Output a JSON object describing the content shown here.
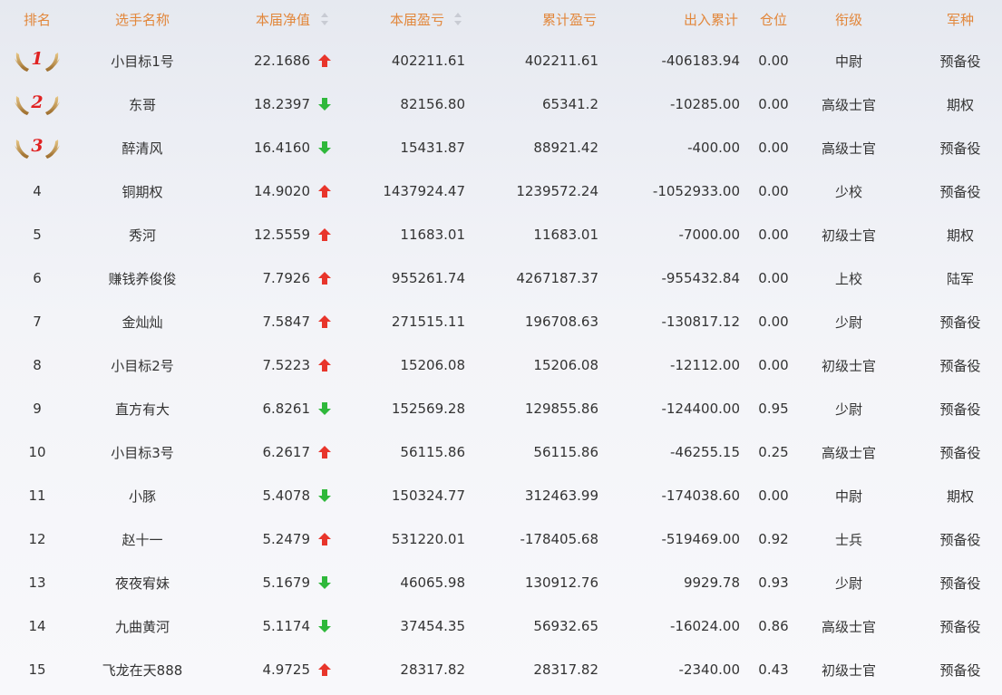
{
  "header": {
    "rank": "排名",
    "name": "选手名称",
    "nav": "本届净值",
    "profit": "本届盈亏",
    "cumulative": "累计盈亏",
    "flow": "出入累计",
    "position": "仓位",
    "military_rank": "衔级",
    "arm": "军种"
  },
  "colors": {
    "header_text": "#e2873b",
    "up_arrow": "#e8352b",
    "down_arrow": "#2fb83b",
    "medal_number": "#e02222"
  },
  "rows": [
    {
      "rank": "1",
      "medal": true,
      "name": "小目标1号",
      "nav": "22.1686",
      "trend": "up",
      "profit": "402211.61",
      "cumulative": "402211.61",
      "flow": "-406183.94",
      "position": "0.00",
      "military_rank": "中尉",
      "arm": "预备役"
    },
    {
      "rank": "2",
      "medal": true,
      "name": "东哥",
      "nav": "18.2397",
      "trend": "down",
      "profit": "82156.80",
      "cumulative": "65341.2",
      "flow": "-10285.00",
      "position": "0.00",
      "military_rank": "高级士官",
      "arm": "期权"
    },
    {
      "rank": "3",
      "medal": true,
      "name": "醉清风",
      "nav": "16.4160",
      "trend": "down",
      "profit": "15431.87",
      "cumulative": "88921.42",
      "flow": "-400.00",
      "position": "0.00",
      "military_rank": "高级士官",
      "arm": "预备役"
    },
    {
      "rank": "4",
      "medal": false,
      "name": "铜期权",
      "nav": "14.9020",
      "trend": "up",
      "profit": "1437924.47",
      "cumulative": "1239572.24",
      "flow": "-1052933.00",
      "position": "0.00",
      "military_rank": "少校",
      "arm": "预备役"
    },
    {
      "rank": "5",
      "medal": false,
      "name": "秀河",
      "nav": "12.5559",
      "trend": "up",
      "profit": "11683.01",
      "cumulative": "11683.01",
      "flow": "-7000.00",
      "position": "0.00",
      "military_rank": "初级士官",
      "arm": "期权"
    },
    {
      "rank": "6",
      "medal": false,
      "name": "赚钱养俊俊",
      "nav": "7.7926",
      "trend": "up",
      "profit": "955261.74",
      "cumulative": "4267187.37",
      "flow": "-955432.84",
      "position": "0.00",
      "military_rank": "上校",
      "arm": "陆军"
    },
    {
      "rank": "7",
      "medal": false,
      "name": "金灿灿",
      "nav": "7.5847",
      "trend": "up",
      "profit": "271515.11",
      "cumulative": "196708.63",
      "flow": "-130817.12",
      "position": "0.00",
      "military_rank": "少尉",
      "arm": "预备役"
    },
    {
      "rank": "8",
      "medal": false,
      "name": "小目标2号",
      "nav": "7.5223",
      "trend": "up",
      "profit": "15206.08",
      "cumulative": "15206.08",
      "flow": "-12112.00",
      "position": "0.00",
      "military_rank": "初级士官",
      "arm": "预备役"
    },
    {
      "rank": "9",
      "medal": false,
      "name": "直方有大",
      "nav": "6.8261",
      "trend": "down",
      "profit": "152569.28",
      "cumulative": "129855.86",
      "flow": "-124400.00",
      "position": "0.95",
      "military_rank": "少尉",
      "arm": "预备役"
    },
    {
      "rank": "10",
      "medal": false,
      "name": "小目标3号",
      "nav": "6.2617",
      "trend": "up",
      "profit": "56115.86",
      "cumulative": "56115.86",
      "flow": "-46255.15",
      "position": "0.25",
      "military_rank": "高级士官",
      "arm": "预备役"
    },
    {
      "rank": "11",
      "medal": false,
      "name": "小豚",
      "nav": "5.4078",
      "trend": "down",
      "profit": "150324.77",
      "cumulative": "312463.99",
      "flow": "-174038.60",
      "position": "0.00",
      "military_rank": "中尉",
      "arm": "期权"
    },
    {
      "rank": "12",
      "medal": false,
      "name": "赵十一",
      "nav": "5.2479",
      "trend": "up",
      "profit": "531220.01",
      "cumulative": "-178405.68",
      "flow": "-519469.00",
      "position": "0.92",
      "military_rank": "士兵",
      "arm": "预备役"
    },
    {
      "rank": "13",
      "medal": false,
      "name": "夜夜宥妹",
      "nav": "5.1679",
      "trend": "down",
      "profit": "46065.98",
      "cumulative": "130912.76",
      "flow": "9929.78",
      "position": "0.93",
      "military_rank": "少尉",
      "arm": "预备役"
    },
    {
      "rank": "14",
      "medal": false,
      "name": "九曲黄河",
      "nav": "5.1174",
      "trend": "down",
      "profit": "37454.35",
      "cumulative": "56932.65",
      "flow": "-16024.00",
      "position": "0.86",
      "military_rank": "高级士官",
      "arm": "预备役"
    },
    {
      "rank": "15",
      "medal": false,
      "name": "飞龙在天888",
      "nav": "4.9725",
      "trend": "up",
      "profit": "28317.82",
      "cumulative": "28317.82",
      "flow": "-2340.00",
      "position": "0.43",
      "military_rank": "初级士官",
      "arm": "预备役"
    }
  ]
}
